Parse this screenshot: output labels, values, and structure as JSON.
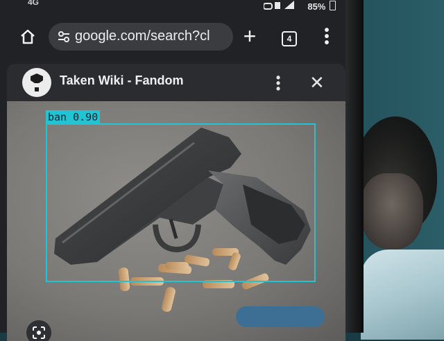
{
  "status_bar": {
    "left_text": "4G",
    "signal_icons": "📶",
    "battery": "85%"
  },
  "browser": {
    "url": "google.com/search?cl",
    "new_tab": "+",
    "tab_count": "4",
    "menu": "⋮"
  },
  "sheet": {
    "title": "Taken Wiki - Fandom",
    "menu": "⋮",
    "close": "✕"
  },
  "detection": {
    "label": "ban 0.90",
    "color": "#22c4d4"
  },
  "colors": {
    "sheet_bg": "#2a2c2f",
    "url_pill": "#3a3c3f",
    "detection_box": "#22c4d4"
  }
}
